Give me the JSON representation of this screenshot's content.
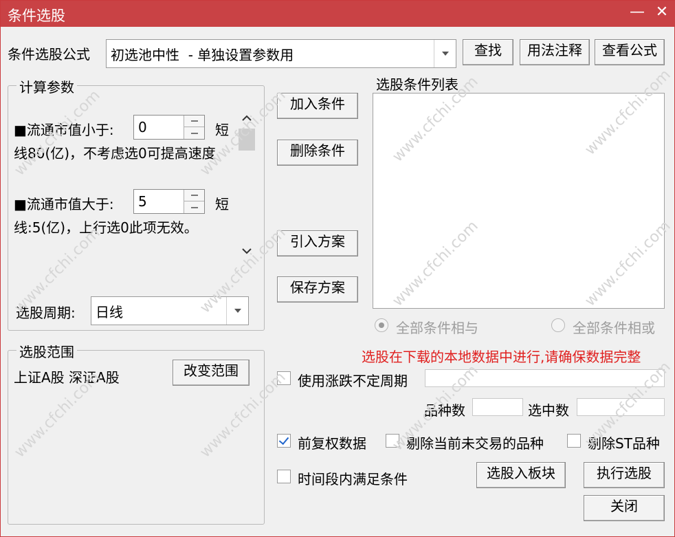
{
  "window": {
    "title": "条件选股",
    "minimize_label": "—",
    "close_label": "✕"
  },
  "formula": {
    "label": "条件选股公式",
    "selected": "初选池中性  - 单独设置参数用",
    "find_button": "查找",
    "usage_button": "用法注释",
    "view_button": "查看公式"
  },
  "params": {
    "group_title": "计算参数",
    "items": [
      {
        "label": "■流通市值小于:",
        "value": "0",
        "suffix": "短",
        "note": "线80(亿)，不考虑选0可提高速度"
      },
      {
        "label": "■流通市值大于:",
        "value": "5",
        "suffix": "短",
        "note": "线:5(亿)，上行选0此项无效。"
      }
    ],
    "period_label": "选股周期:",
    "period_value": "日线"
  },
  "middle_buttons": {
    "add": "加入条件",
    "delete": "删除条件",
    "import": "引入方案",
    "save": "保存方案"
  },
  "conditions": {
    "title": "选股条件列表",
    "items": [],
    "radio_and": "全部条件相与",
    "radio_or": "全部条件相或"
  },
  "notice": "选股在下载的本地数据中进行,请确保数据完整",
  "range": {
    "group_title": "选股范围",
    "value": "上证A股 深证A股",
    "change_button": "改变范围"
  },
  "options": {
    "use_variable_period": {
      "label": "使用涨跌不定周期",
      "checked": false
    },
    "variety_count_label": "品种数",
    "selected_count_label": "选中数",
    "forward_adjust": {
      "label": "前复权数据",
      "checked": true
    },
    "exclude_untraded": {
      "label": "剔除当前未交易的品种",
      "checked": false
    },
    "exclude_st": {
      "label": "剔除ST品种",
      "checked": false
    },
    "time_period": {
      "label": "时间段内满足条件",
      "checked": false
    }
  },
  "actions": {
    "to_board": "选股入板块",
    "execute": "执行选股",
    "close": "关闭"
  },
  "watermark_text": "www.cfchi.com",
  "colors": {
    "titlebar": "#c94245",
    "notice": "#e0201f",
    "window_bg": "#f0f0f0"
  }
}
